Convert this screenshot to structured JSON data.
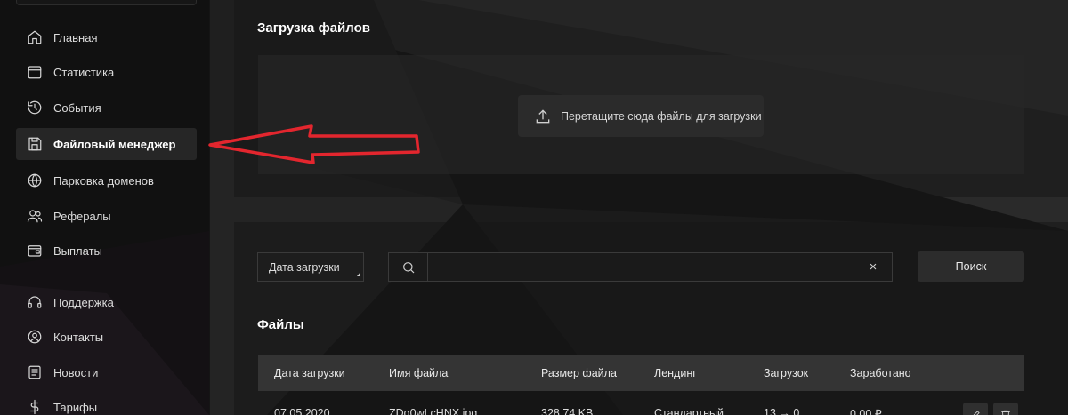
{
  "nav": {
    "main": [
      {
        "label": "Главная",
        "icon": "home-icon"
      },
      {
        "label": "Статистика",
        "icon": "calendar-icon"
      },
      {
        "label": "События",
        "icon": "history-icon"
      },
      {
        "label": "Файловый менеджер",
        "icon": "save-icon",
        "active": true
      },
      {
        "label": "Парковка доменов",
        "icon": "globe-icon"
      },
      {
        "label": "Рефералы",
        "icon": "users-icon"
      },
      {
        "label": "Выплаты",
        "icon": "wallet-icon"
      }
    ],
    "secondary": [
      {
        "label": "Поддержка",
        "icon": "headset-icon"
      },
      {
        "label": "Контакты",
        "icon": "contact-icon"
      },
      {
        "label": "Новости",
        "icon": "news-icon"
      },
      {
        "label": "Тарифы",
        "icon": "dollar-icon"
      }
    ]
  },
  "upload": {
    "title": "Загрузка файлов",
    "drop_label": "Перетащите сюда файлы для загрузки"
  },
  "filters": {
    "date_select": "Дата загрузки",
    "search_placeholder": "",
    "search_value": "",
    "clear": "×",
    "search_button": "Поиск"
  },
  "files": {
    "title": "Файлы",
    "columns": [
      "Дата загрузки",
      "Имя файла",
      "Размер файла",
      "Лендинг",
      "Загрузок",
      "Заработано"
    ],
    "rows": [
      {
        "date": "07.05.2020",
        "name": "ZDg0wLcHNX.jpg",
        "size": "328.74 KB",
        "landing": "Стандартный",
        "downloads": "13 → 0",
        "earned": "0.00 ₽"
      }
    ]
  },
  "colors": {
    "accent_arrow": "#e3262e",
    "active_bg": "#262626",
    "header_bg": "#343434"
  }
}
